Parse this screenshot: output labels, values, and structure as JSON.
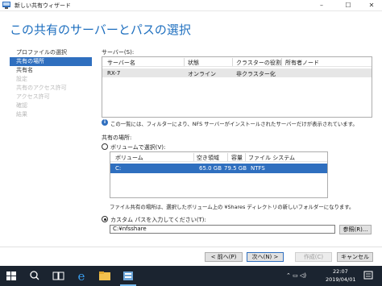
{
  "window": {
    "title": "新しい共有ウィザード"
  },
  "heading": "この共有のサーバーとパスの選択",
  "nav": {
    "items": [
      {
        "label": "プロファイルの選択",
        "state": "normal"
      },
      {
        "label": "共有の場所",
        "state": "active"
      },
      {
        "label": "共有名",
        "state": "normal"
      },
      {
        "label": "設定",
        "state": "disabled"
      },
      {
        "label": "共有のアクセス許可",
        "state": "disabled"
      },
      {
        "label": "アクセス許可",
        "state": "disabled"
      },
      {
        "label": "確認",
        "state": "disabled"
      },
      {
        "label": "結果",
        "state": "disabled"
      }
    ]
  },
  "servers": {
    "label": "サーバー(S):",
    "columns": [
      "サーバー名",
      "状態",
      "クラスターの役割",
      "所有者ノード"
    ],
    "rows": [
      [
        "RX-7",
        "オンライン",
        "非クラスター化",
        ""
      ]
    ]
  },
  "info_text": "この一覧には、フィルターにより、NFS サーバーがインストールされたサーバーだけが表示されています。",
  "location": {
    "label": "共有の場所:",
    "by_volume_label": "ボリュームで選択(V):",
    "volume_columns": [
      "ボリューム",
      "空き領域",
      "容量",
      "ファイル システム"
    ],
    "volume_rows": [
      [
        "C:",
        "65.0 GB",
        "79.5 GB",
        "NTFS"
      ]
    ],
    "volume_note": "ファイル共有の場所は、選択したボリューム上の ¥Shares ディレクトリの新しいフォルダーになります。",
    "custom_path_label": "カスタム パスを入力してください(T):",
    "custom_path_value": "C:¥nfsshare",
    "browse_label": "参照(R)..."
  },
  "buttons": {
    "prev": "< 前へ(P)",
    "next": "次へ(N) >",
    "create": "作成(C)",
    "cancel": "キャンセル"
  },
  "taskbar": {
    "time": "22:07",
    "date": "2019/04/01"
  },
  "colors": {
    "accent": "#2f6fbf",
    "heading": "#1e6fbf",
    "taskbar": "#1b2430"
  }
}
